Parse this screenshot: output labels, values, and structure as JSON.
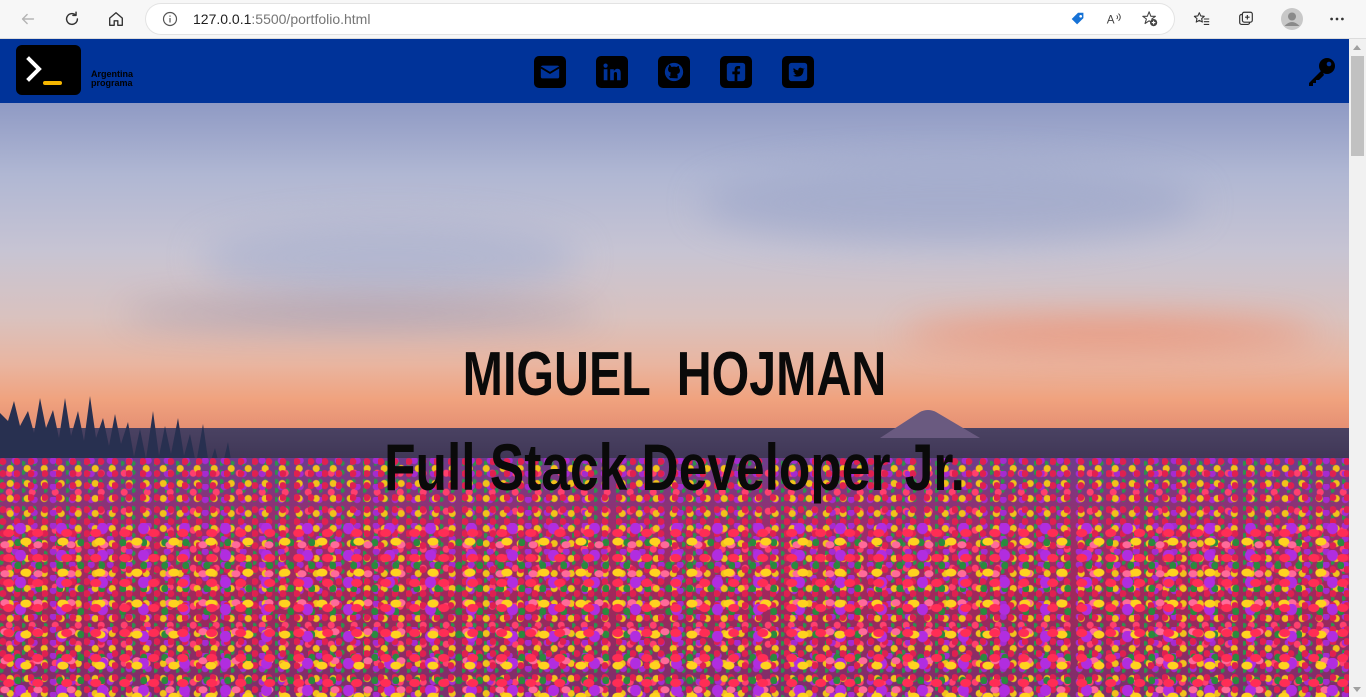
{
  "browser": {
    "url_host": "127.0.0.1",
    "url_rest": ":5500/portfolio.html",
    "back_icon": "back-arrow-icon",
    "refresh_icon": "refresh-icon",
    "home_icon": "home-icon",
    "info_icon": "info-icon",
    "toolbar_icons": [
      "tag-icon",
      "read-aloud-icon",
      "add-favorite-icon",
      "favorites-icon",
      "collections-icon",
      "profile-icon",
      "more-icon"
    ]
  },
  "nav": {
    "background": "#003399",
    "logo_line1": "Argentina",
    "logo_line2": "programa",
    "social": [
      "email-icon",
      "linkedin-icon",
      "github-icon",
      "facebook-icon",
      "twitter-icon"
    ],
    "login_icon": "key-icon"
  },
  "hero": {
    "name": "MIGUEL  HOJMAN",
    "role": "Full Stack Developer Jr."
  }
}
